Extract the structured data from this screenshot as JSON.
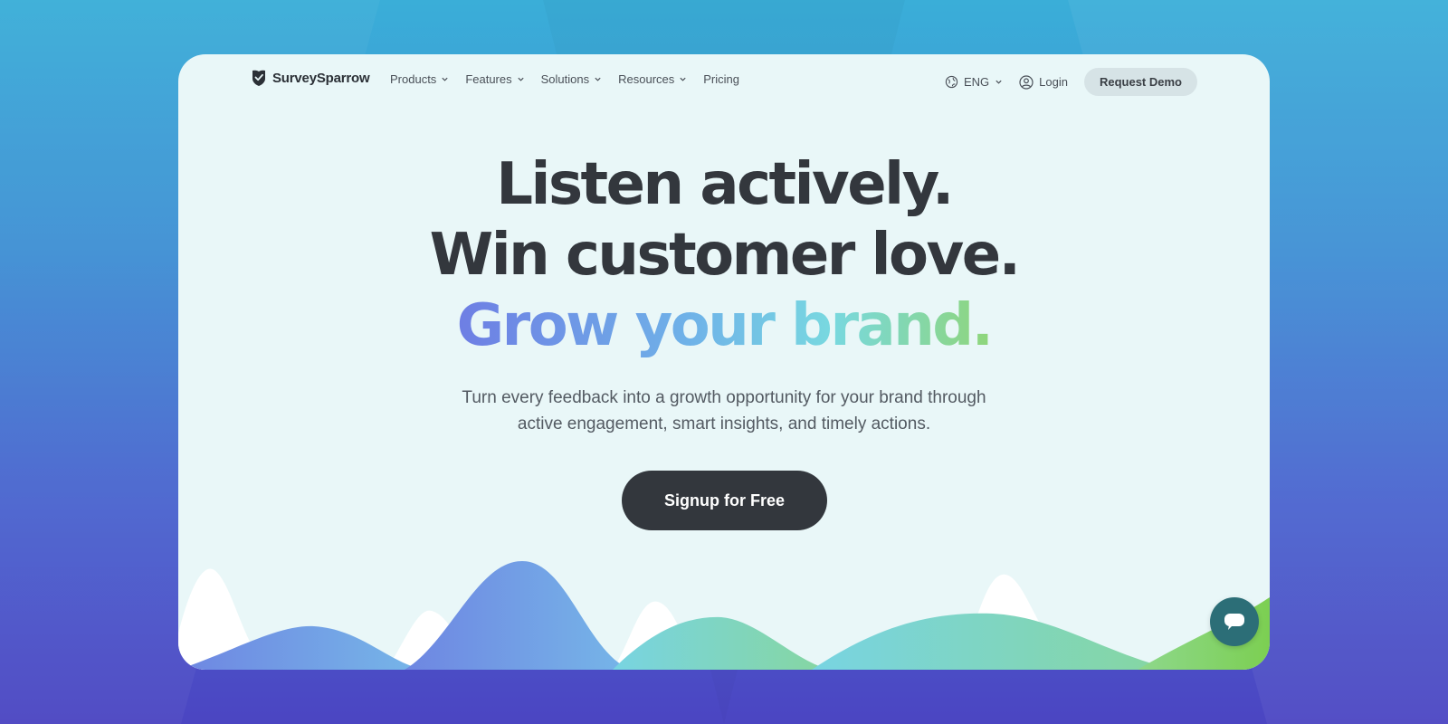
{
  "brand": {
    "name": "SurveySparrow"
  },
  "nav": {
    "items": [
      {
        "label": "Products",
        "has_dropdown": true
      },
      {
        "label": "Features",
        "has_dropdown": true
      },
      {
        "label": "Solutions",
        "has_dropdown": true
      },
      {
        "label": "Resources",
        "has_dropdown": true
      },
      {
        "label": "Pricing",
        "has_dropdown": false
      }
    ],
    "language": "ENG",
    "login_label": "Login",
    "demo_label": "Request Demo"
  },
  "hero": {
    "line1": "Listen actively.",
    "line2": "Win customer love.",
    "line3": "Grow your brand.",
    "subtitle_line1": "Turn every feedback into a growth opportunity for your brand through",
    "subtitle_line2": "active engagement, smart insights, and timely actions.",
    "cta_label": "Signup for Free"
  },
  "colors": {
    "page_bg_top": "#3aaed8",
    "page_bg_bottom": "#4b45c2",
    "card_bg": "#e9f7f8",
    "text_dark": "#33373d",
    "cta_bg": "#33373d",
    "chat_bg": "#2c6e77",
    "gradient": [
      "#6e7ee4",
      "#6fb4e8",
      "#78d8e0",
      "#8fd67a"
    ]
  },
  "icons": {
    "logo": "sparrow-logo-icon",
    "language": "globe-icon",
    "login": "user-circle-icon",
    "dropdown": "chevron-down-icon",
    "chat": "chat-bubble-icon"
  }
}
